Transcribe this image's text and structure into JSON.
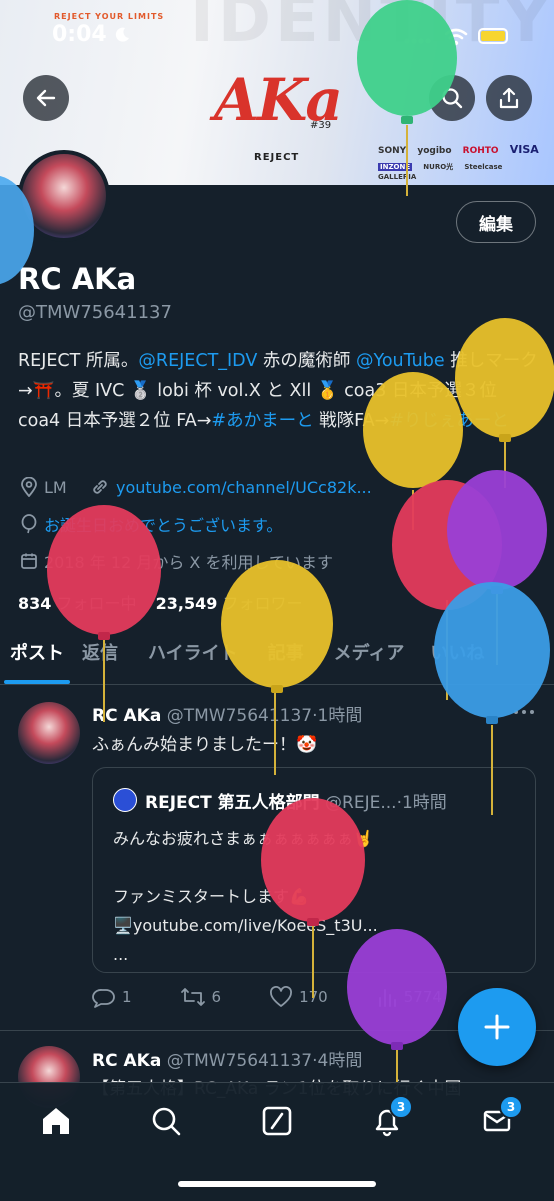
{
  "status_bar": {
    "time": "0:04"
  },
  "banner": {
    "tagline": "REJECT YOUR LIMITS",
    "ghost_text": "IDENTITY",
    "title": "AKa",
    "number": "#39",
    "brand": "REJECT",
    "sponsors_row1": [
      "SONY",
      "yogibo",
      "ROHTO",
      "VISA"
    ],
    "sponsors_row2": [
      "INZONE",
      "NURO光",
      "Steelcase",
      "GALLERIA"
    ]
  },
  "profile": {
    "edit_label": "編集",
    "name": "RC AKa",
    "handle": "@TMW75641137",
    "bio": {
      "t1": "REJECT 所属。",
      "l1": "@REJECT_IDV",
      "t2": " 赤の魔術師 ",
      "l2": "@YouTube",
      "t3": " 推しマーク →⛩️。夏 IVC 🥈 lobi 杯 vol.X と Xll 🥇 coa3 日本予選３位 coa4 日本予選２位 FA→",
      "l3": "#あかまーと",
      "t4": " 戦隊FA→",
      "l4": "#りじぇあーと"
    },
    "location": "LM",
    "website": "youtube.com/channel/UCc82k...",
    "birthday": "お誕生日おめでとうございます。",
    "joined": "2018 年 12 月から X を利用しています",
    "following_count": "834",
    "following_label": "フォロー中",
    "followers_count": "23,549",
    "followers_label": "フォロワー"
  },
  "tabs": [
    "ポスト",
    "返信",
    "ハイライト",
    "記事",
    "メディア",
    "いいね"
  ],
  "posts": [
    {
      "name": "RC AKa",
      "handle": "@TMW75641137",
      "time": "·1時間",
      "text": "ふぁんみ始まりましたー！🤡",
      "quote": {
        "name": "REJECT 第五人格部門",
        "handle": "@REJE...",
        "time": "·1時間",
        "line1": "みんなお疲れさまぁぁぁぁぁぁぁ🤘",
        "line2": "ファンミスタートします💪",
        "line3": "🖥️youtube.com/live/KoeeS_t3U...",
        "line4": "..."
      },
      "replies": "1",
      "reposts": "6",
      "likes": "170",
      "views": "5774"
    },
    {
      "name": "RC AKa",
      "handle": "@TMW75641137",
      "time": "·4時間",
      "text": "【第五人格】RC_AKa ラン1位を取りに行く中国"
    }
  ],
  "bottom_nav": {
    "notifications_badge": "3",
    "messages_badge": "3"
  },
  "colors": {
    "background": "#15202b",
    "accent": "#1d9bf0",
    "muted": "#8b98a5",
    "divider": "#38444d"
  }
}
